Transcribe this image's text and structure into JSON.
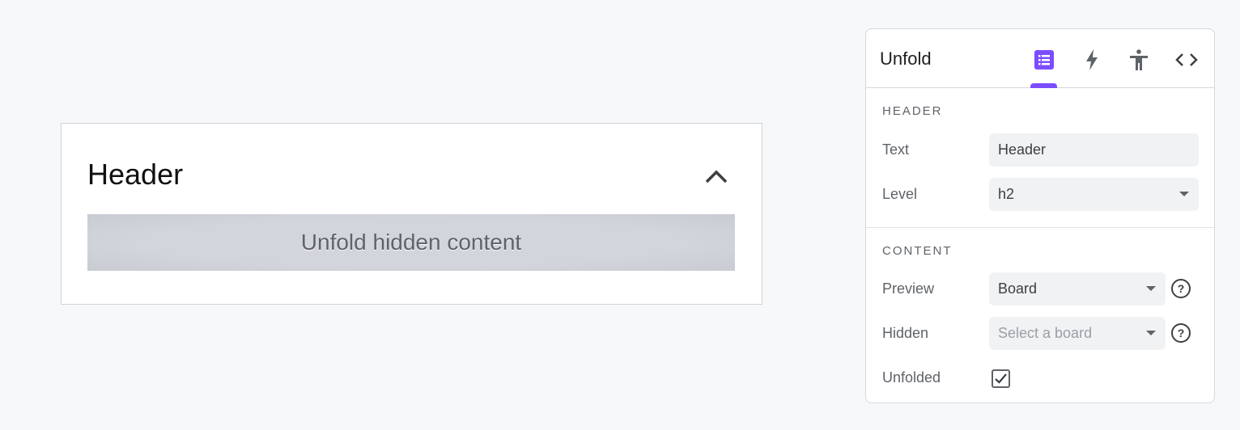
{
  "canvas": {
    "header_text": "Header",
    "hidden_placeholder": "Unfold hidden content",
    "chevron_icon": "chevron-up-icon"
  },
  "panel": {
    "title": "Unfold",
    "tabs": [
      {
        "name": "properties",
        "icon": "list-icon",
        "active": true
      },
      {
        "name": "actions",
        "icon": "lightning-icon"
      },
      {
        "name": "accessibility",
        "icon": "accessibility-icon"
      },
      {
        "name": "code",
        "icon": "code-icon"
      }
    ],
    "accent": "#7c4dff",
    "header_section": {
      "title": "HEADER",
      "text_label": "Text",
      "text_value": "Header",
      "level_label": "Level",
      "level_value": "h2"
    },
    "content_section": {
      "title": "CONTENT",
      "preview_label": "Preview",
      "preview_value": "Board",
      "hidden_label": "Hidden",
      "hidden_placeholder": "Select a board",
      "unfolded_label": "Unfolded",
      "unfolded_checked": true,
      "help_glyph": "?"
    }
  }
}
